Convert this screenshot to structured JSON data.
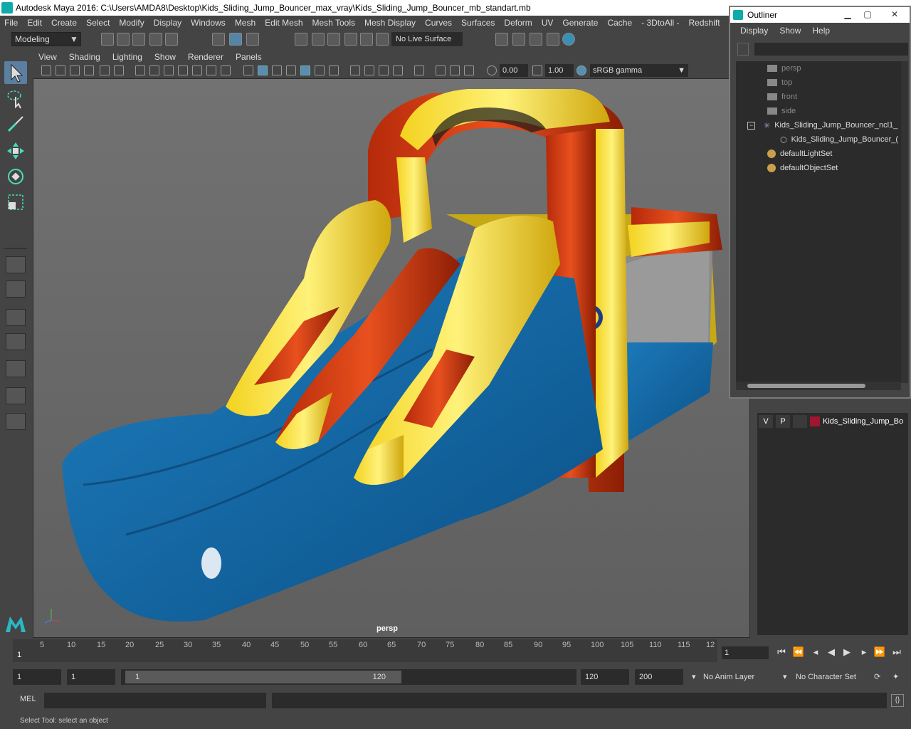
{
  "window": {
    "title": "Autodesk Maya 2016: C:\\Users\\AMDA8\\Desktop\\Kids_Sliding_Jump_Bouncer_max_vray\\Kids_Sliding_Jump_Bouncer_mb_standart.mb"
  },
  "menubar": [
    "File",
    "Edit",
    "Create",
    "Select",
    "Modify",
    "Display",
    "Windows",
    "Mesh",
    "Edit Mesh",
    "Mesh Tools",
    "Mesh Display",
    "Curves",
    "Surfaces",
    "Deform",
    "UV",
    "Generate",
    "Cache",
    "- 3DtoAll -",
    "Redshift"
  ],
  "shelf": {
    "mode": "Modeling",
    "live_surface": "No Live Surface"
  },
  "panel": {
    "menus": [
      "View",
      "Shading",
      "Lighting",
      "Show",
      "Renderer",
      "Panels"
    ],
    "exposure": "0.00",
    "gamma_value": "1.00",
    "color_space": "sRGB gamma"
  },
  "viewport": {
    "camera_label": "persp"
  },
  "outliner": {
    "title": "Outliner",
    "menus": [
      "Display",
      "Show",
      "Help"
    ],
    "items": [
      {
        "label": "persp",
        "dim": true
      },
      {
        "label": "top",
        "dim": true
      },
      {
        "label": "front",
        "dim": true
      },
      {
        "label": "side",
        "dim": true
      },
      {
        "label": "Kids_Sliding_Jump_Bouncer_ncl1_",
        "dim": false
      },
      {
        "label": "Kids_Sliding_Jump_Bouncer_(",
        "dim": false
      },
      {
        "label": "defaultLightSet",
        "dim": false
      },
      {
        "label": "defaultObjectSet",
        "dim": false
      }
    ]
  },
  "layers": {
    "v": "V",
    "p": "P",
    "layer_name": "Kids_Sliding_Jump_Bo",
    "swatch_color": "#a01530"
  },
  "timeline": {
    "ticks": [
      "5",
      "10",
      "15",
      "20",
      "25",
      "30",
      "35",
      "40",
      "45",
      "50",
      "55",
      "60",
      "65",
      "70",
      "75",
      "80",
      "85",
      "90",
      "95",
      "100",
      "105",
      "110",
      "115",
      "12"
    ],
    "start_marker": "1",
    "current_frame": "1"
  },
  "range": {
    "start": "1",
    "playback_start": "1",
    "slider_start": "1",
    "slider_end": "120",
    "playback_end": "120",
    "end": "200",
    "anim_layer": "No Anim Layer",
    "character_set": "No Character Set"
  },
  "cmdline": {
    "label": "MEL"
  },
  "helpline": {
    "text": "Select Tool: select an object"
  }
}
